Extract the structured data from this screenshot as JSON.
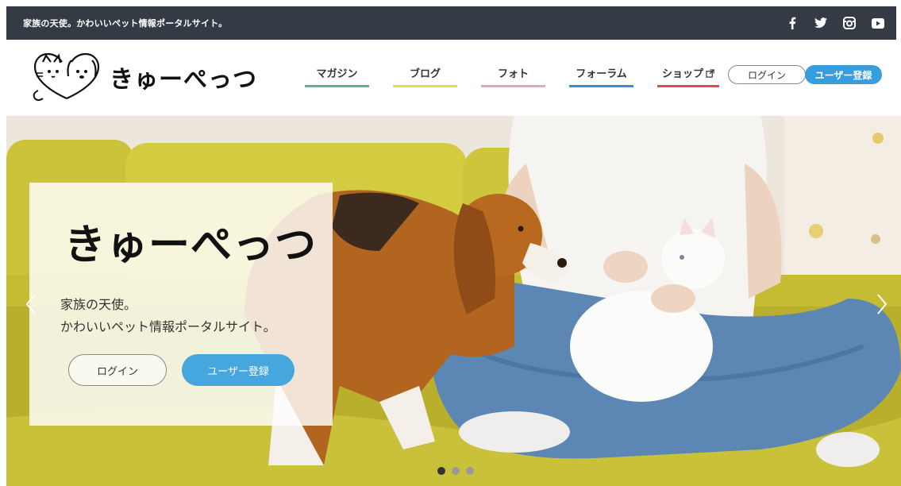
{
  "topbar": {
    "tagline": "家族の天使。かわいいペット情報ポータルサイト。",
    "social": [
      {
        "name": "facebook-icon"
      },
      {
        "name": "twitter-icon"
      },
      {
        "name": "instagram-icon"
      },
      {
        "name": "youtube-icon"
      }
    ]
  },
  "header": {
    "logo_text": "きゅーぺっつ",
    "nav": [
      {
        "label": "マガジン",
        "color": "#5fb39a"
      },
      {
        "label": "ブログ",
        "color": "#e8d84a"
      },
      {
        "label": "フォト",
        "color": "#e5a3c8"
      },
      {
        "label": "フォーラム",
        "color": "#3b8fd0"
      },
      {
        "label": "ショップ",
        "color": "#e5484f",
        "icon": "external-link-icon"
      }
    ],
    "login_label": "ログイン",
    "register_label": "ユーザー登録",
    "accent": "#3a9ddb"
  },
  "hero": {
    "title": "きゅーぺっつ",
    "line1": "家族の天使。",
    "line2": "かわいいペット情報ポータルサイト。",
    "login_label": "ログイン",
    "register_label": "ユーザー登録",
    "slide_count": 3,
    "active_slide": 1
  }
}
